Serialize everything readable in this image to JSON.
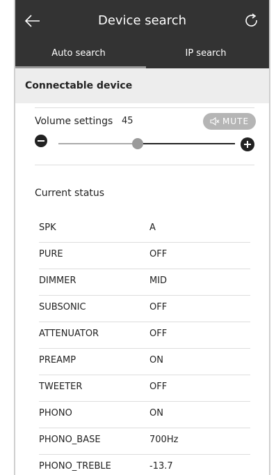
{
  "header": {
    "title": "Device search"
  },
  "tabs": [
    {
      "label": "Auto search",
      "active": true
    },
    {
      "label": "IP search",
      "active": false
    }
  ],
  "section": {
    "title": "Connectable device"
  },
  "volume": {
    "label": "Volume settings",
    "value": "45",
    "level_percent": 45,
    "mute_label": "MUTE"
  },
  "status": {
    "title": "Current status",
    "rows": [
      {
        "key": "SPK",
        "value": "A"
      },
      {
        "key": "PURE",
        "value": "OFF"
      },
      {
        "key": "DIMMER",
        "value": "MID"
      },
      {
        "key": "SUBSONIC",
        "value": "OFF"
      },
      {
        "key": "ATTENUATOR",
        "value": "OFF"
      },
      {
        "key": "PREAMP",
        "value": "ON"
      },
      {
        "key": "TWEETER",
        "value": "OFF"
      },
      {
        "key": "PHONO",
        "value": "ON"
      },
      {
        "key": "PHONO_BASE",
        "value": "700Hz"
      },
      {
        "key": "PHONO_TREBLE",
        "value": "-13.7"
      }
    ]
  },
  "colors": {
    "header_bg": "#333333",
    "section_bg": "#ededed",
    "mute_bg": "#b5b5b5",
    "slider_thumb": "#9a9a9a"
  },
  "icons": {
    "back": "arrow-left-icon",
    "refresh": "refresh-icon",
    "mute": "speaker-mute-icon",
    "decrease": "minus-circle-icon",
    "increase": "plus-circle-icon"
  }
}
